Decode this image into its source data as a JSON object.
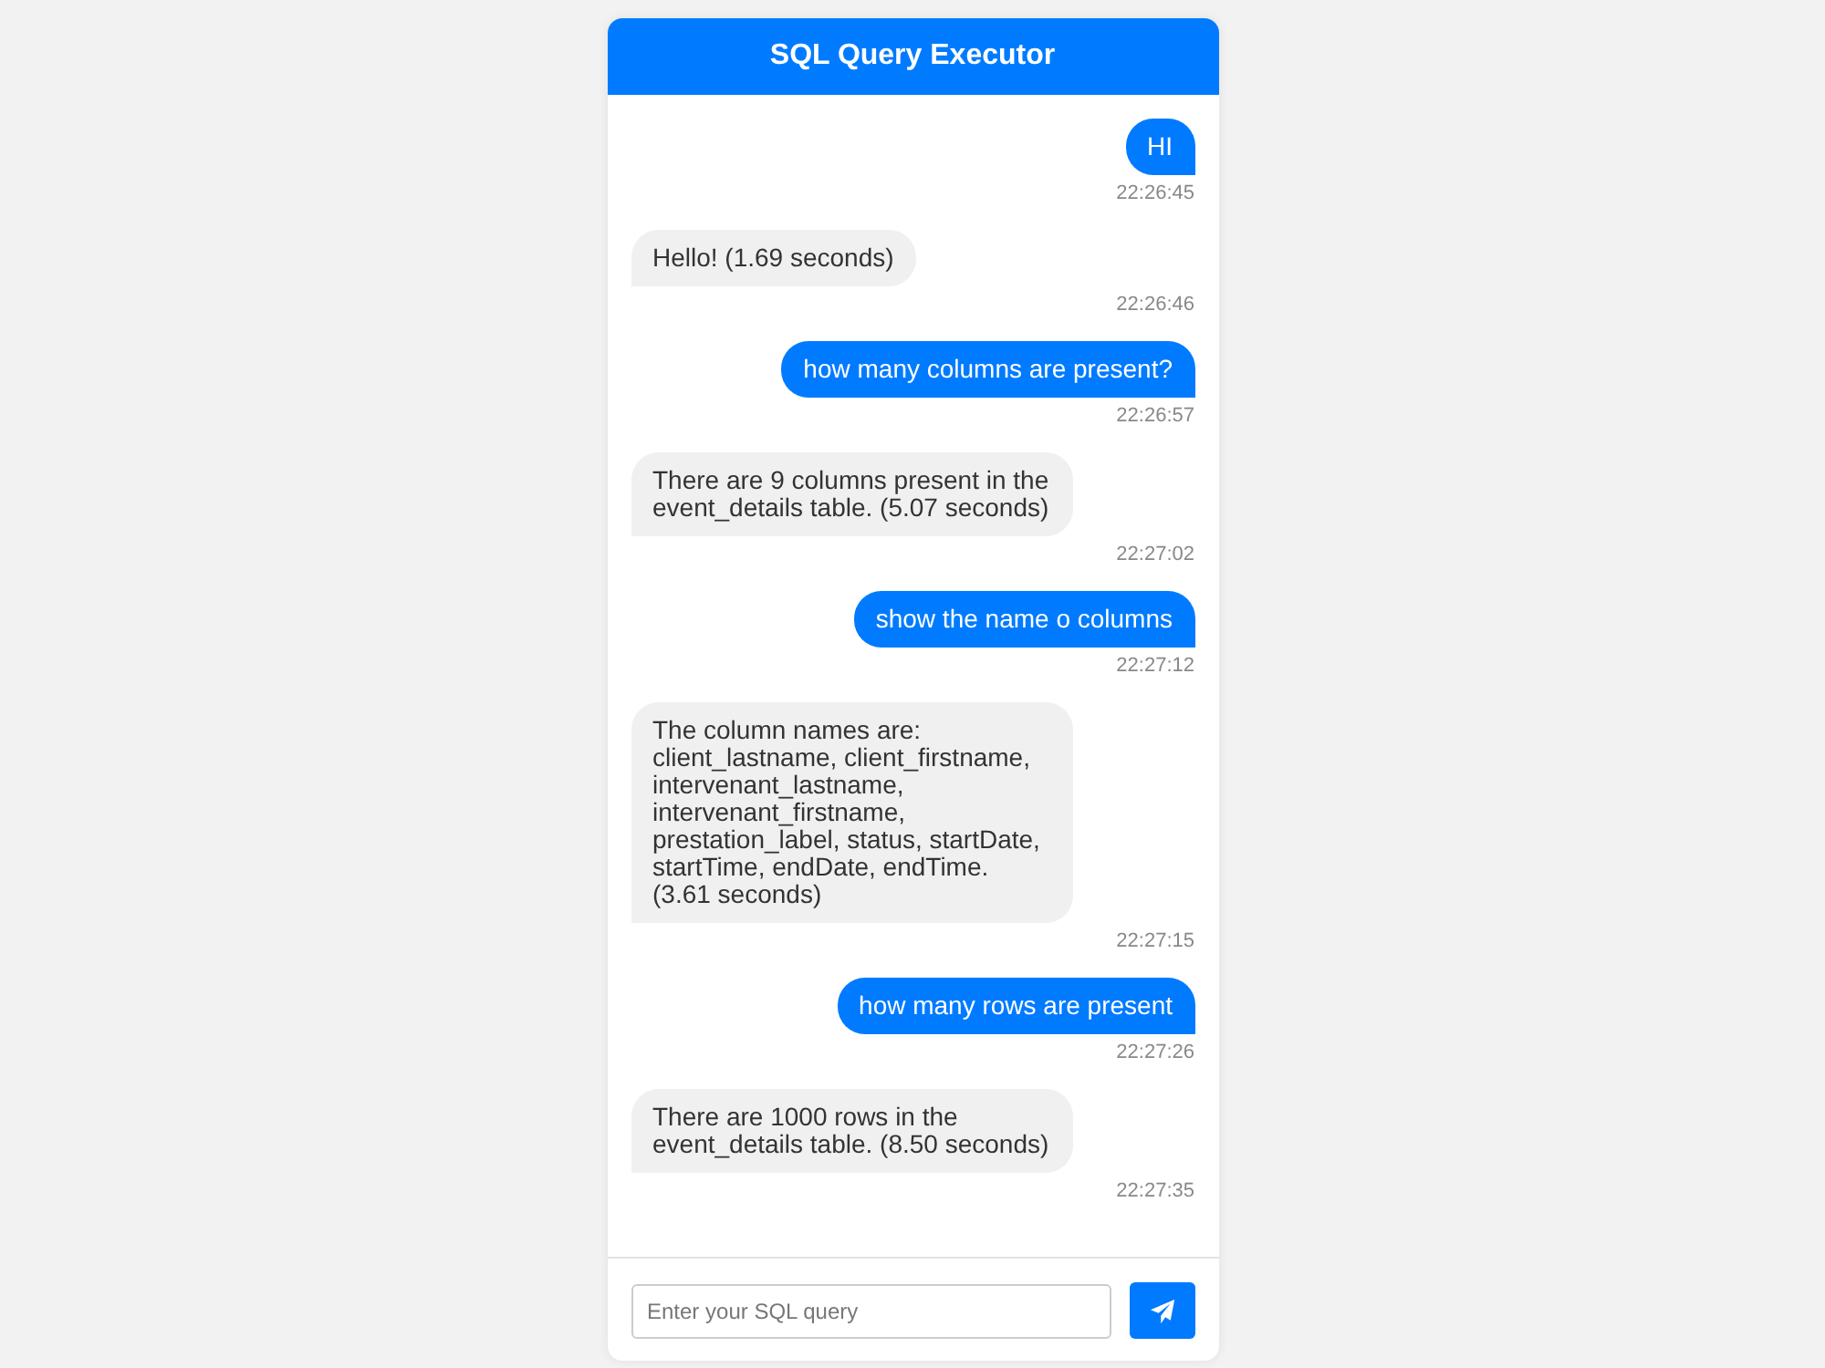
{
  "header": {
    "title": "SQL Query Executor"
  },
  "messages": [
    {
      "kind": "user",
      "text": "HI",
      "time": "22:26:45"
    },
    {
      "kind": "bot",
      "text": "Hello! (1.69 seconds)",
      "time": "22:26:46"
    },
    {
      "kind": "user",
      "text": "how many columns are present?",
      "time": "22:26:57"
    },
    {
      "kind": "bot",
      "text": "There are 9 columns present in the event_details table. (5.07 seconds)",
      "time": "22:27:02"
    },
    {
      "kind": "user",
      "text": "show the name o columns",
      "time": "22:27:12"
    },
    {
      "kind": "bot",
      "text": "The column names are: client_lastname, client_firstname, intervenant_lastname, intervenant_firstname, prestation_label, status, startDate, startTime, endDate, endTime. (3.61 seconds)",
      "time": "22:27:15"
    },
    {
      "kind": "user",
      "text": "how many rows are present",
      "time": "22:27:26"
    },
    {
      "kind": "bot",
      "text": "There are 1000 rows in the event_details table. (8.50 seconds)",
      "time": "22:27:35"
    }
  ],
  "composer": {
    "placeholder": "Enter your SQL query"
  }
}
